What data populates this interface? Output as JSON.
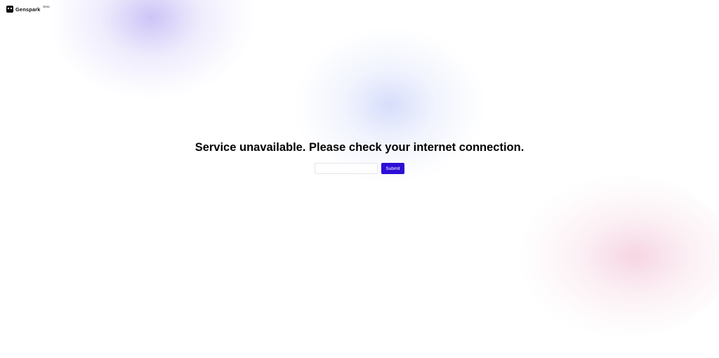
{
  "brand": {
    "name": "Genspark",
    "badge": "Beta",
    "icon": "genspark-logo-icon"
  },
  "error": {
    "message": "Service unavailable. Please check your internet connection."
  },
  "form": {
    "input_value": "",
    "input_placeholder": "",
    "submit_label": "Submit"
  },
  "colors": {
    "accent": "#2c0fd6",
    "text": "#000000",
    "blob_purple": "#c4baf5",
    "blob_blue": "#d0d8fa",
    "blob_pink": "#f4cede"
  }
}
